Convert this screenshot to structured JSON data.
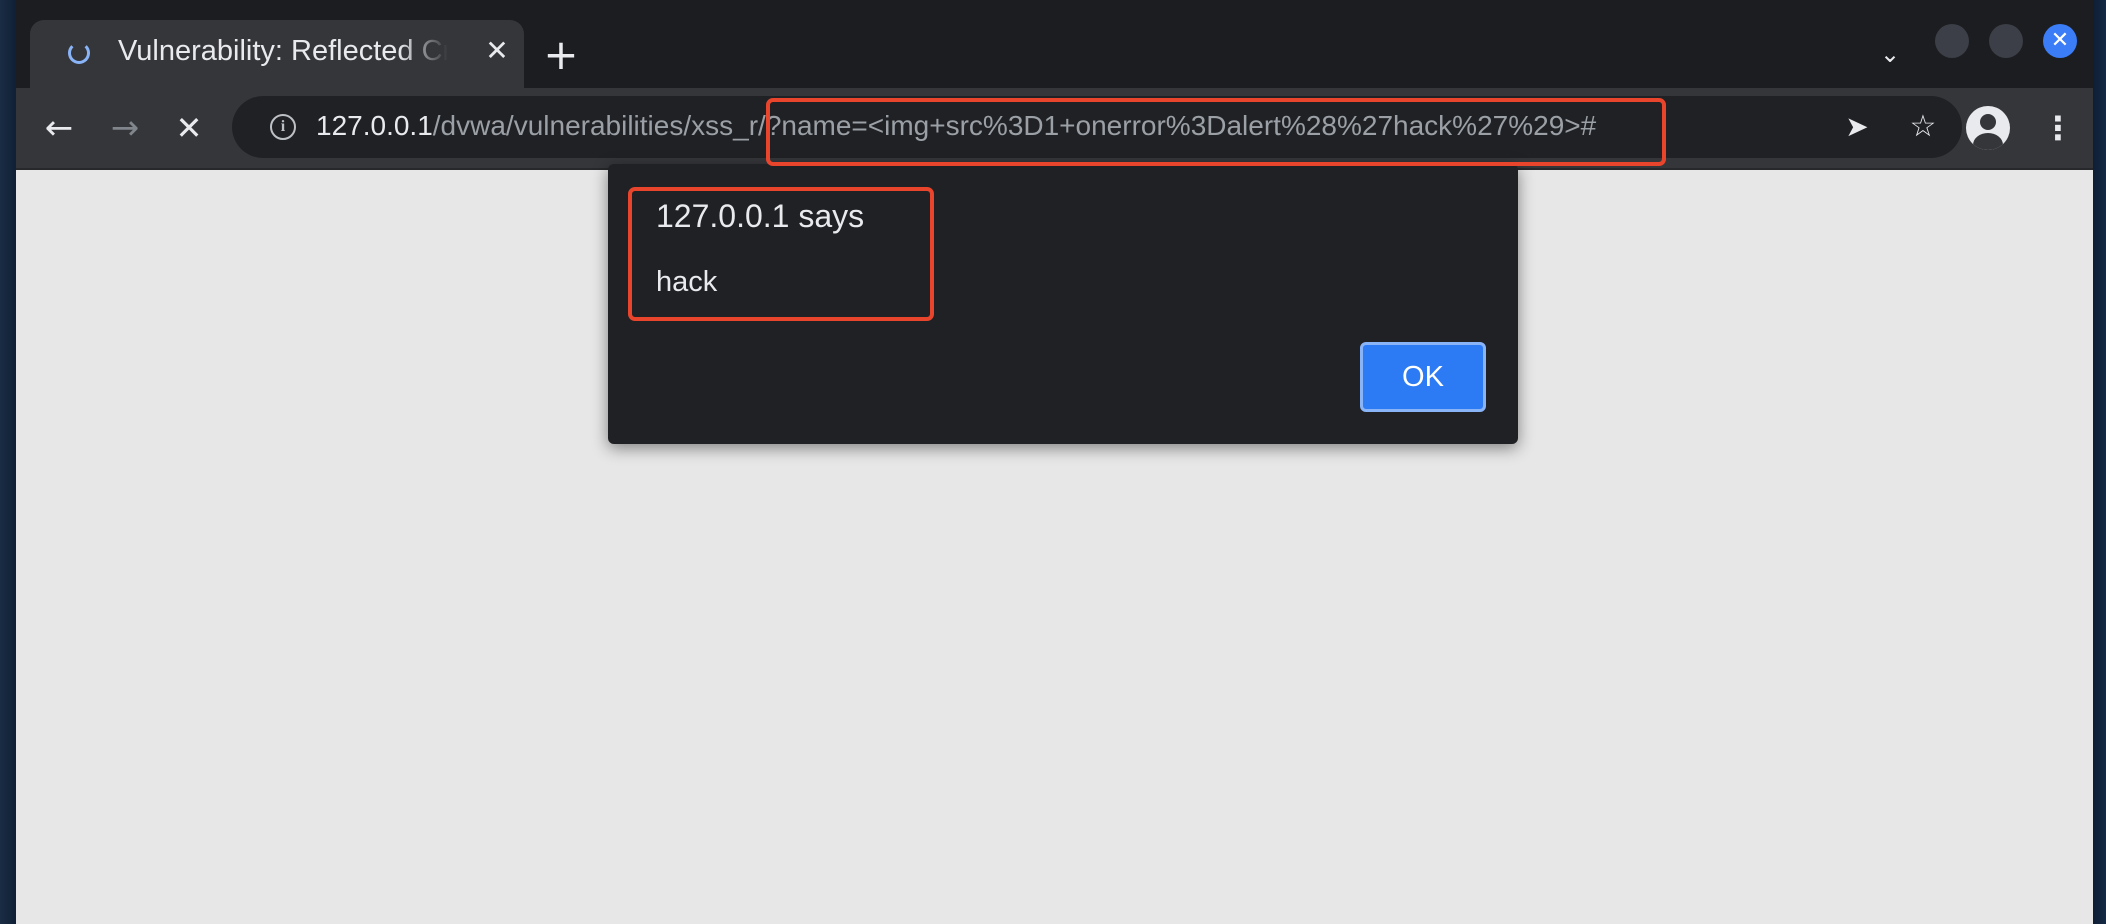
{
  "tab": {
    "title": "Vulnerability: Reflected Cross Site Scripting (XSS)",
    "close_glyph": "✕"
  },
  "new_tab_glyph": "+",
  "tab_search_glyph": "⌄",
  "window_controls": {
    "close_glyph": "✕"
  },
  "toolbar": {
    "back_glyph": "←",
    "forward_glyph": "→",
    "stop_glyph": "✕",
    "info_glyph": "i",
    "send_glyph": "➤",
    "star_glyph": "☆",
    "menu_glyph": "⋮"
  },
  "address_bar": {
    "host": "127.0.0.1",
    "path": "/dvwa/vulnerabilities/xss_r/",
    "query": "?name=<img+src%3D1+onerror%3Dalert%28%27hack%27%29>#"
  },
  "alert": {
    "title": "127.0.0.1 says",
    "message": "hack",
    "ok_label": "OK"
  },
  "colors": {
    "annotation": "#e8452c",
    "accent": "#2d7bf4",
    "page_background": "#e7e7e7"
  }
}
